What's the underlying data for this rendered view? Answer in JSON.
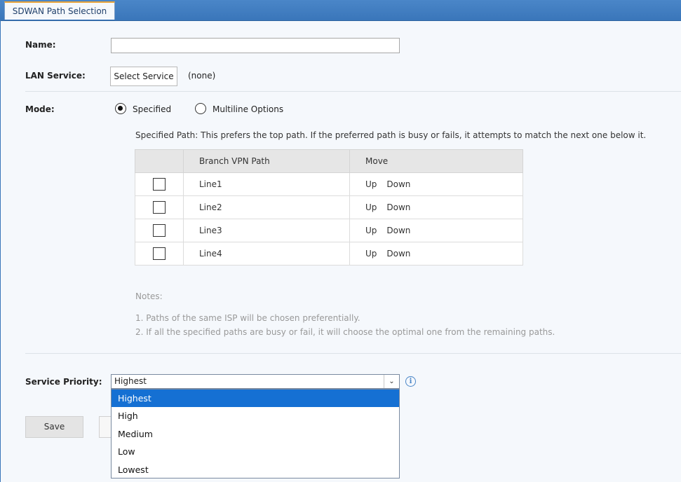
{
  "tab": {
    "title": "SDWAN Path Selection"
  },
  "form": {
    "name_label": "Name:",
    "name_value": "",
    "lan_label": "LAN Service:",
    "select_service_label": "Select Service",
    "lan_value": "(none)",
    "mode_label": "Mode:",
    "mode_options": [
      {
        "label": "Specified",
        "selected": true
      },
      {
        "label": "Multiline Options",
        "selected": false
      }
    ],
    "description": "Specified Path: This prefers the top path. If the preferred path is busy or fails, it attempts to match the next one below it."
  },
  "table": {
    "headers": [
      "",
      "Branch VPN Path",
      "Move"
    ],
    "rows": [
      {
        "path": "Line1",
        "up": "Up",
        "down": "Down"
      },
      {
        "path": "Line2",
        "up": "Up",
        "down": "Down"
      },
      {
        "path": "Line3",
        "up": "Up",
        "down": "Down"
      },
      {
        "path": "Line4",
        "up": "Up",
        "down": "Down"
      }
    ]
  },
  "notes": {
    "title": "Notes:",
    "items": [
      "1. Paths of the same ISP will be chosen preferentially.",
      "2. If all the specified paths are busy or fail, it will choose the optimal one from the remaining paths."
    ]
  },
  "priority": {
    "label": "Service Priority:",
    "value": "Highest",
    "options": [
      "Highest",
      "High",
      "Medium",
      "Low",
      "Lowest"
    ],
    "selected_index": 0
  },
  "buttons": {
    "save": "Save"
  },
  "colors": {
    "accent": "#3a76ba",
    "selection": "#1570d3",
    "tab_highlight": "#e8a33b"
  }
}
